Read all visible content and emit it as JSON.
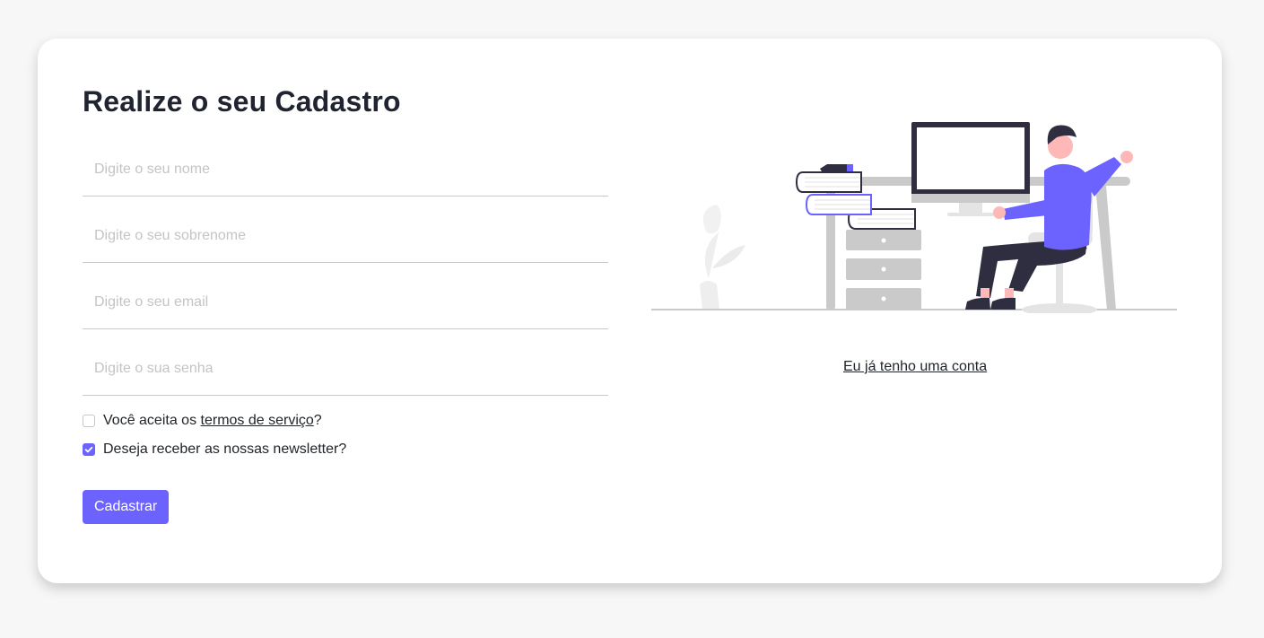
{
  "form": {
    "title": "Realize o seu Cadastro",
    "name_placeholder": "Digite o seu nome",
    "surname_placeholder": "Digite o seu sobrenome",
    "email_placeholder": "Digite o seu email",
    "password_placeholder": "Digite o sua senha",
    "terms_prefix": "Você aceita os ",
    "terms_link": "termos de serviço",
    "terms_suffix": "?",
    "terms_checked": false,
    "newsletter_label": "Deseja receber as nossas newsletter?",
    "newsletter_checked": true,
    "submit_label": "Cadastrar"
  },
  "side": {
    "login_link": "Eu já tenho uma conta"
  },
  "colors": {
    "accent": "#6c63ff",
    "dark": "#2f2e41",
    "light_gray": "#cacaca"
  },
  "icons": {
    "illustration": "person-at-desk-illustration",
    "check": "check-icon"
  }
}
